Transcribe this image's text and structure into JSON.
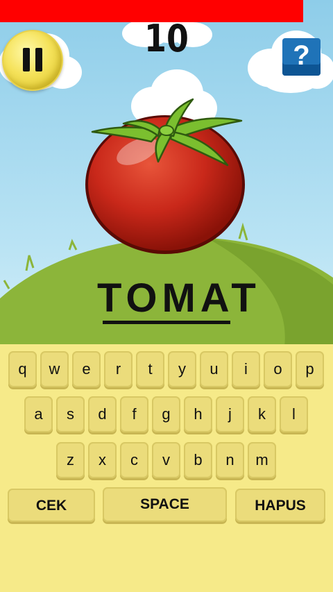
{
  "hud": {
    "score": "10",
    "timer_fraction": 0.91,
    "pause_icon": "pause-icon",
    "help_label": "?"
  },
  "puzzle": {
    "word": "TOMAT",
    "image": "tomato"
  },
  "keyboard": {
    "row1": [
      "q",
      "w",
      "e",
      "r",
      "t",
      "y",
      "u",
      "i",
      "o",
      "p"
    ],
    "row2": [
      "a",
      "s",
      "d",
      "f",
      "g",
      "h",
      "j",
      "k",
      "l"
    ],
    "row3": [
      "z",
      "x",
      "c",
      "v",
      "b",
      "n",
      "m"
    ],
    "check_label": "CEK",
    "space_label": "SPACE",
    "delete_label": "HAPUS"
  },
  "colors": {
    "timer": "#ff0000",
    "keyboard_bg": "#f6ea89",
    "key": "#ebdc7b",
    "help_button": "#1f73b8"
  }
}
